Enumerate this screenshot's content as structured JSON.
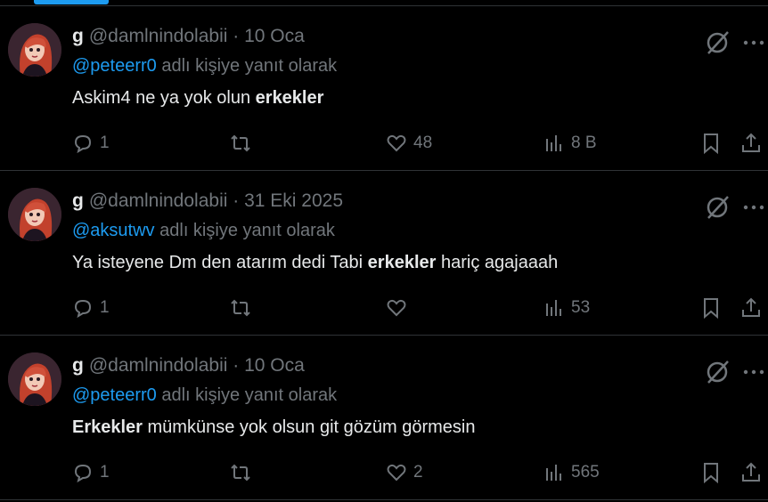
{
  "tweets": [
    {
      "display_name": "g",
      "handle": "@damlnindolabii",
      "dot": "·",
      "date": "10 Oca",
      "replying_mention": "@peteerr0",
      "replying_suffix": "adlı kişiye yanıt olarak",
      "text_parts": [
        "Askim4 ne ya yok olun ",
        "erkekler",
        ""
      ],
      "replies": "1",
      "retweets": "",
      "likes": "48",
      "views": "8 B"
    },
    {
      "display_name": "g",
      "handle": "@damlnindolabii",
      "dot": "·",
      "date": "31 Eki 2025",
      "replying_mention": "@aksutwv",
      "replying_suffix": "adlı kişiye yanıt olarak",
      "text_parts": [
        "Ya isteyene Dm den atarım dedi Tabi ",
        "erkekler",
        " hariç agajaaah"
      ],
      "replies": "1",
      "retweets": "",
      "likes": "",
      "views": "53"
    },
    {
      "display_name": "g",
      "handle": "@damlnindolabii",
      "dot": "·",
      "date": "10 Oca",
      "replying_mention": "@peteerr0",
      "replying_suffix": "adlı kişiye yanıt olarak",
      "text_parts": [
        "",
        "Erkekler",
        " mümkünse yok olsun git gözüm görmesin"
      ],
      "replies": "1",
      "retweets": "",
      "likes": "2",
      "views": "565"
    }
  ],
  "icons": {
    "grok": "grok-icon",
    "more": "more-icon",
    "reply": "reply-icon",
    "retweet": "retweet-icon",
    "like": "heart-icon",
    "views": "views-icon",
    "bookmark": "bookmark-icon",
    "share": "share-icon"
  },
  "colors": {
    "background": "#000000",
    "text": "#e7e9ea",
    "muted": "#71767b",
    "accent": "#1d9bf0",
    "border": "#2f3336"
  }
}
